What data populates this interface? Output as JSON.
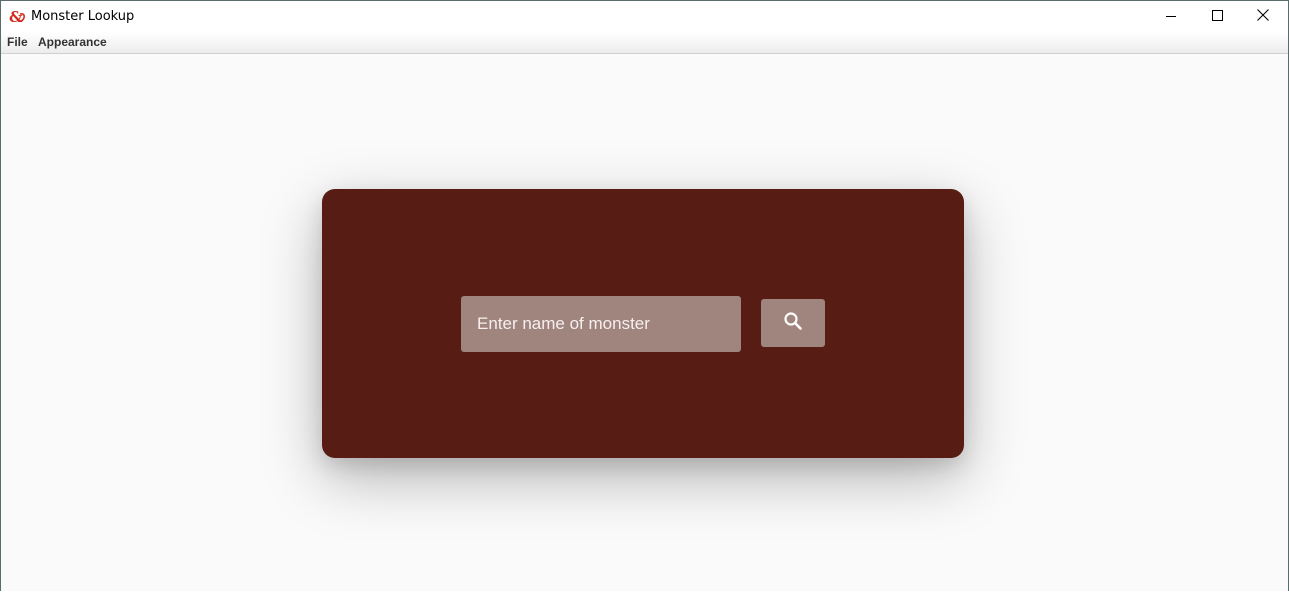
{
  "window": {
    "title": "Monster Lookup",
    "app_icon": "dnd-ampersand-icon",
    "controls": [
      "minimize-icon",
      "maximize-icon",
      "close-icon"
    ]
  },
  "menu": {
    "items": [
      {
        "label": "File"
      },
      {
        "label": "Appearance"
      }
    ]
  },
  "search": {
    "value": "",
    "placeholder": "Enter name of monster",
    "button_icon": "search-icon"
  },
  "colors": {
    "card_background": "#571d14",
    "input_background": "#a0847e",
    "page_background": "#fafafa",
    "icon_accent": "#d52b1e"
  }
}
